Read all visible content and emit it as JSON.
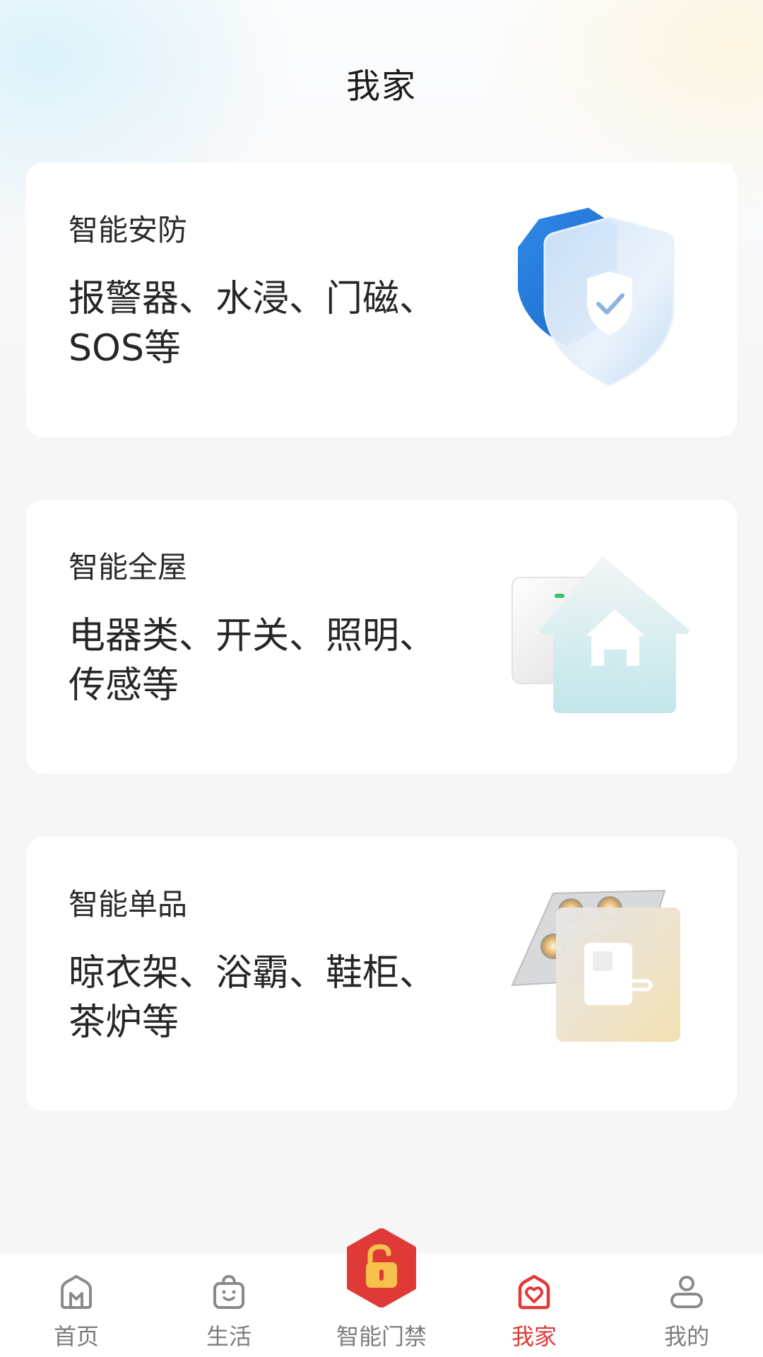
{
  "header": {
    "title": "我家"
  },
  "cards": [
    {
      "title": "智能安防",
      "desc_line1": "报警器、水浸、门磁、",
      "desc_line2": "SOS等",
      "icon": "shield-icon"
    },
    {
      "title": "智能全屋",
      "desc_line1": "电器类、开关、照明、",
      "desc_line2": "传感等",
      "icon": "smart-home-icon"
    },
    {
      "title": "智能单品",
      "desc_line1": "晾衣架、浴霸、鞋柜、",
      "desc_line2": "茶炉等",
      "icon": "smart-lock-icon"
    }
  ],
  "tabbar": {
    "items": [
      {
        "label": "首页",
        "icon": "home-icon"
      },
      {
        "label": "生活",
        "icon": "shopping-bag-icon"
      },
      {
        "label": "智能门禁",
        "icon": "unlock-icon"
      },
      {
        "label": "我家",
        "icon": "heart-house-icon",
        "active": true
      },
      {
        "label": "我的",
        "icon": "user-icon"
      }
    ]
  },
  "colors": {
    "accent": "#e03a38",
    "inactive": "#7c7c7c",
    "card_bg": "#ffffff",
    "page_bg": "#f6f6f7"
  }
}
